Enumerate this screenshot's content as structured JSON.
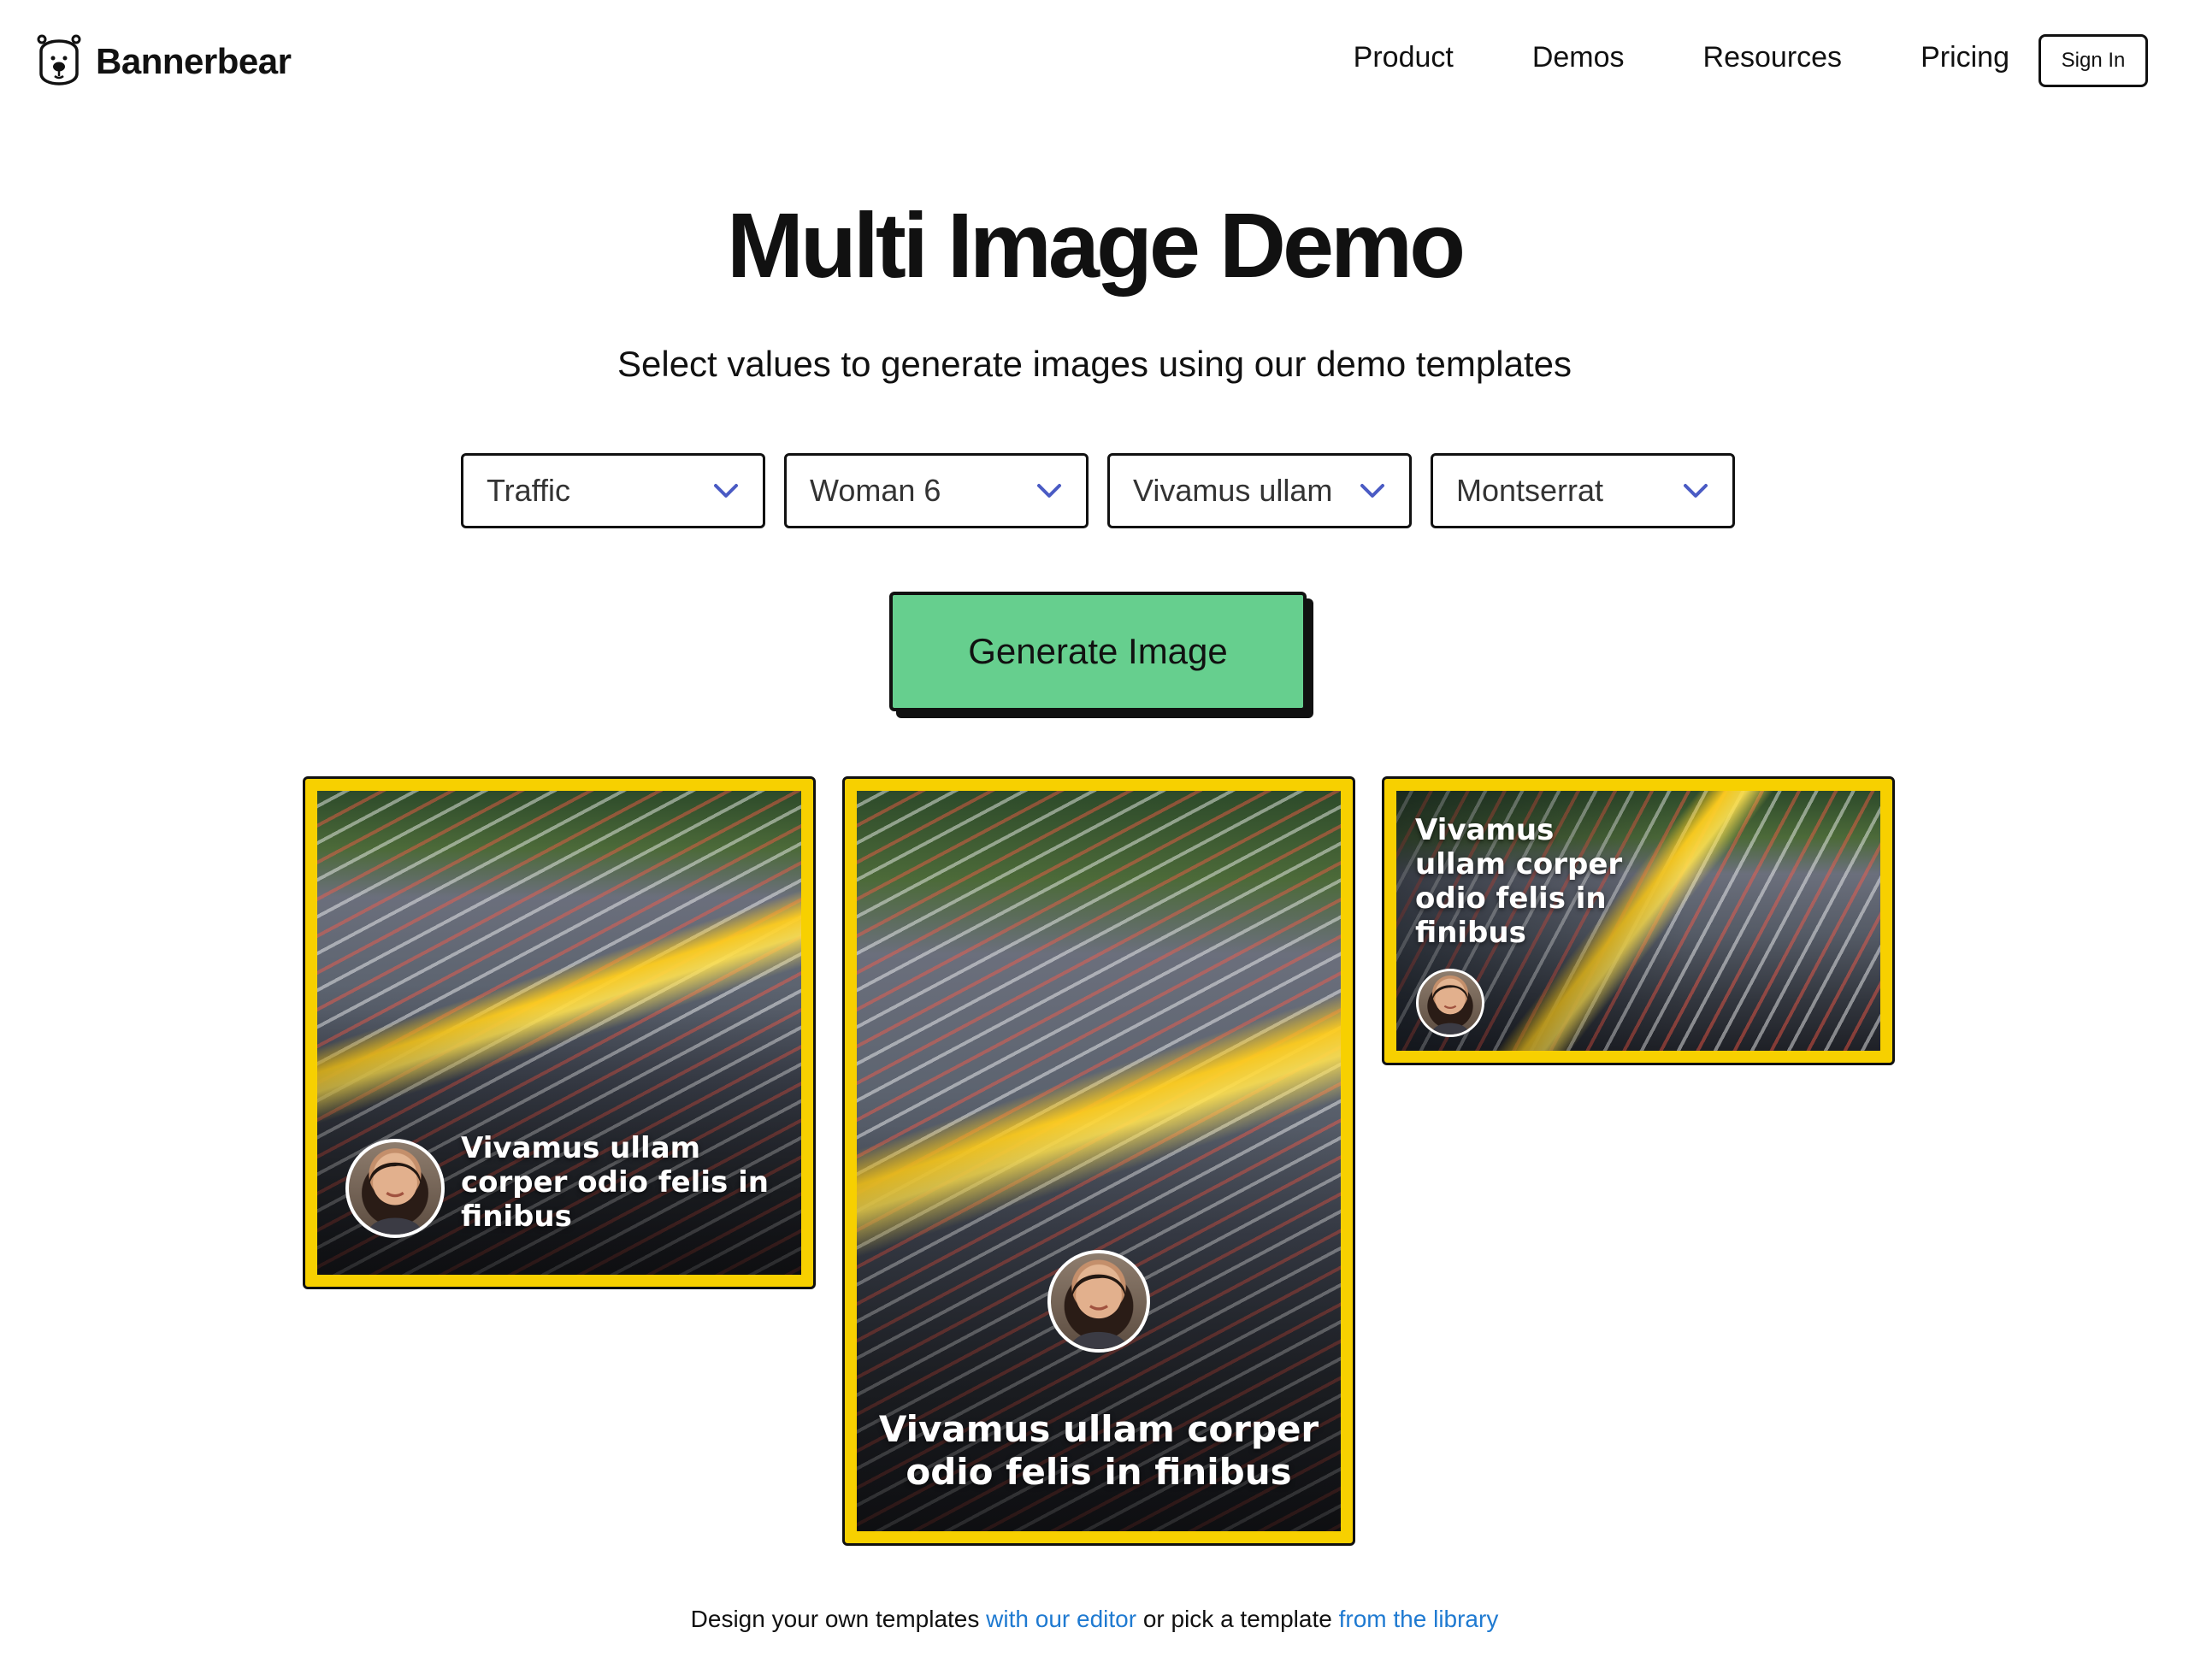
{
  "header": {
    "brand": "Bannerbear",
    "nav": [
      {
        "label": "Product"
      },
      {
        "label": "Demos"
      },
      {
        "label": "Resources"
      },
      {
        "label": "Pricing"
      }
    ],
    "signin_label": "Sign In"
  },
  "hero": {
    "title": "Multi Image Demo",
    "subtitle": "Select values to generate images using our demo templates"
  },
  "selects": [
    {
      "value": "Traffic"
    },
    {
      "value": "Woman 6"
    },
    {
      "value": "Vivamus ullam"
    },
    {
      "value": "Montserrat"
    }
  ],
  "generate_label": "Generate Image",
  "cards": [
    {
      "caption": "Vivamus ullam corper odio felis in finibus"
    },
    {
      "caption": "Vivamus ullam corper odio felis in finibus"
    },
    {
      "caption": "Vivamus ullam corper odio felis in finibus"
    }
  ],
  "footer": {
    "text1": "Design your own templates ",
    "link1": "with our editor",
    "text2": " or pick a template ",
    "link2": "from the library"
  },
  "colors": {
    "accent_green": "#66cf8e",
    "card_border_yellow": "#f7d000",
    "link_blue": "#1f7ad1",
    "chevron_blue": "#4a5bc4"
  },
  "icons": {
    "logo": "bear-head-icon",
    "select_chevron": "chevron-down-icon"
  }
}
